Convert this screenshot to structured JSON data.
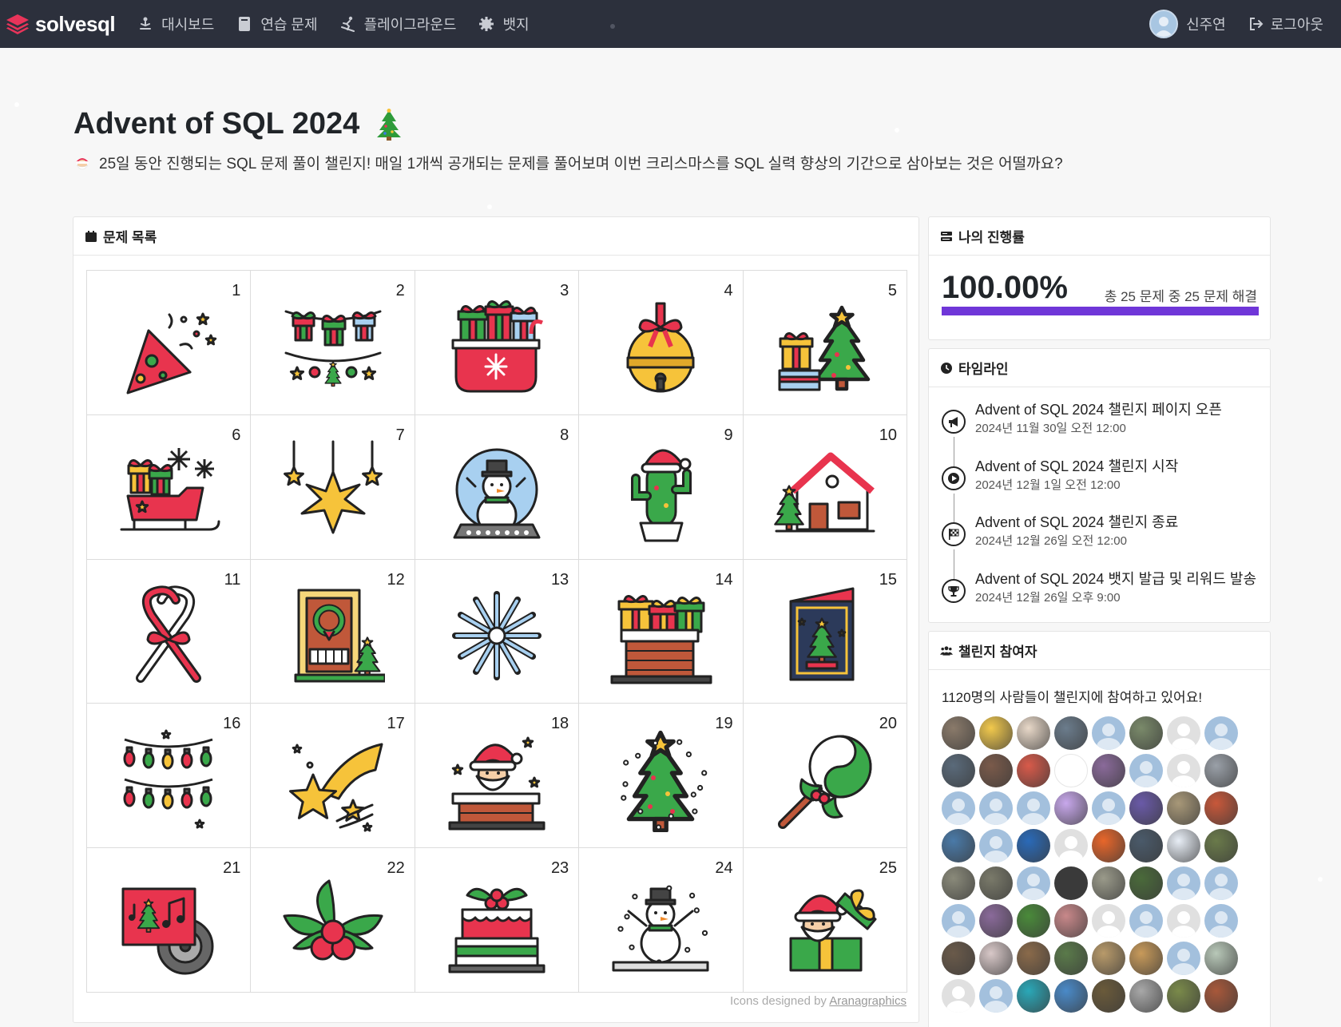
{
  "nav": {
    "brand": "solvesql",
    "links": [
      {
        "label": "대시보드",
        "icon": "person-meditation-icon"
      },
      {
        "label": "연습 문제",
        "icon": "book-icon"
      },
      {
        "label": "플레이그라운드",
        "icon": "person-skiing-icon"
      },
      {
        "label": "뱃지",
        "icon": "badge-gear-icon"
      }
    ],
    "user_name": "신주연",
    "logout_label": "로그아웃"
  },
  "header": {
    "title": "Advent of SQL 2024",
    "subtitle": "25일 동안 진행되는 SQL 문제 풀이 챌린지! 매일 1개씩 공개되는 문제를 풀어보며 이번 크리스마스를 SQL 실력 향상의 기간으로 삼아보는 것은 어떨까요?"
  },
  "problems": {
    "header": "문제 목록",
    "days": [
      {
        "num": "1",
        "icon": "party-popper-icon"
      },
      {
        "num": "2",
        "icon": "gift-garland-icon"
      },
      {
        "num": "3",
        "icon": "gift-sack-icon"
      },
      {
        "num": "4",
        "icon": "jingle-bell-icon"
      },
      {
        "num": "5",
        "icon": "tree-with-gifts-icon"
      },
      {
        "num": "6",
        "icon": "sleigh-icon"
      },
      {
        "num": "7",
        "icon": "hanging-stars-icon"
      },
      {
        "num": "8",
        "icon": "snow-globe-icon"
      },
      {
        "num": "9",
        "icon": "cactus-santa-hat-icon"
      },
      {
        "num": "10",
        "icon": "snowy-house-icon"
      },
      {
        "num": "11",
        "icon": "candy-canes-icon"
      },
      {
        "num": "12",
        "icon": "wreath-door-icon"
      },
      {
        "num": "13",
        "icon": "snowflake-icon"
      },
      {
        "num": "14",
        "icon": "chimney-gifts-icon"
      },
      {
        "num": "15",
        "icon": "christmas-card-icon"
      },
      {
        "num": "16",
        "icon": "string-lights-icon"
      },
      {
        "num": "17",
        "icon": "shooting-star-icon"
      },
      {
        "num": "18",
        "icon": "santa-chimney-icon"
      },
      {
        "num": "19",
        "icon": "decorated-tree-icon"
      },
      {
        "num": "20",
        "icon": "lollipop-holly-icon"
      },
      {
        "num": "21",
        "icon": "christmas-music-icon"
      },
      {
        "num": "22",
        "icon": "holly-icon"
      },
      {
        "num": "23",
        "icon": "christmas-cake-icon"
      },
      {
        "num": "24",
        "icon": "snowman-icon"
      },
      {
        "num": "25",
        "icon": "santa-gift-box-icon"
      }
    ],
    "credit_prefix": "Icons designed by ",
    "credit_link": "Aranagraphics"
  },
  "progress": {
    "header": "나의 진행률",
    "percent_text": "100.00%",
    "fill_fraction": 1.0,
    "detail": "총 25 문제 중 25 문제 해결",
    "bar_color": "#6f36d8"
  },
  "timeline": {
    "header": "타임라인",
    "items": [
      {
        "title": "Advent of SQL 2024 챌린지 페이지 오픈",
        "date": "2024년 11월 30일 오전 12:00",
        "icon": "megaphone-icon"
      },
      {
        "title": "Advent of SQL 2024 챌린지 시작",
        "date": "2024년 12월 1일 오전 12:00",
        "icon": "play-icon"
      },
      {
        "title": "Advent of SQL 2024 챌린지 종료",
        "date": "2024년 12월 26일 오전 12:00",
        "icon": "checkered-flag-icon"
      },
      {
        "title": "Advent of SQL 2024 뱃지 발급 및 리워드 발송",
        "date": "2024년 12월 26일 오후 9:00",
        "icon": "trophy-icon"
      }
    ]
  },
  "participants": {
    "header": "챌린지 참여자",
    "summary": "1120명의 사람들이 챌린지에 참여하고 있어요!",
    "avatars": [
      "#8a7a6a",
      "#f2c94c",
      "#e8d8c8",
      "#6b7c8c",
      "default",
      "#7a8a6a",
      "gray",
      "default",
      "#5a6a7a",
      "#7a5a4a",
      "#d85a4a",
      "white",
      "#8a6a9a",
      "default",
      "gray",
      "#9aa0a8",
      "default",
      "default",
      "default",
      "#c8a8ec",
      "default",
      "#6a5aa8",
      "#a89878",
      "#c8583a",
      "#4a7aa8",
      "default",
      "#2a6ab8",
      "gray",
      "#e8662a",
      "#4a5a6a",
      "#e8eef6",
      "#6a7a4a",
      "#8a8a7a",
      "#7a7a6a",
      "default",
      "#3a3a3a",
      "#9a9a8a",
      "#4a6a3a",
      "default",
      "default",
      "default",
      "#8a6a9a",
      "#4a8a3a",
      "#c8888a",
      "gray",
      "default",
      "gray",
      "default",
      "#6a5a4a",
      "#d8c8c8",
      "#8a6a4a",
      "#5a7a4a",
      "#b89a6a",
      "#c89a5a",
      "default",
      "#b8c8b8",
      "gray",
      "default",
      "#2aa8b8",
      "#4a8ac8",
      "#6a5a3a",
      "#a8a8a8",
      "#7a8a4a",
      "#a8583a"
    ]
  }
}
